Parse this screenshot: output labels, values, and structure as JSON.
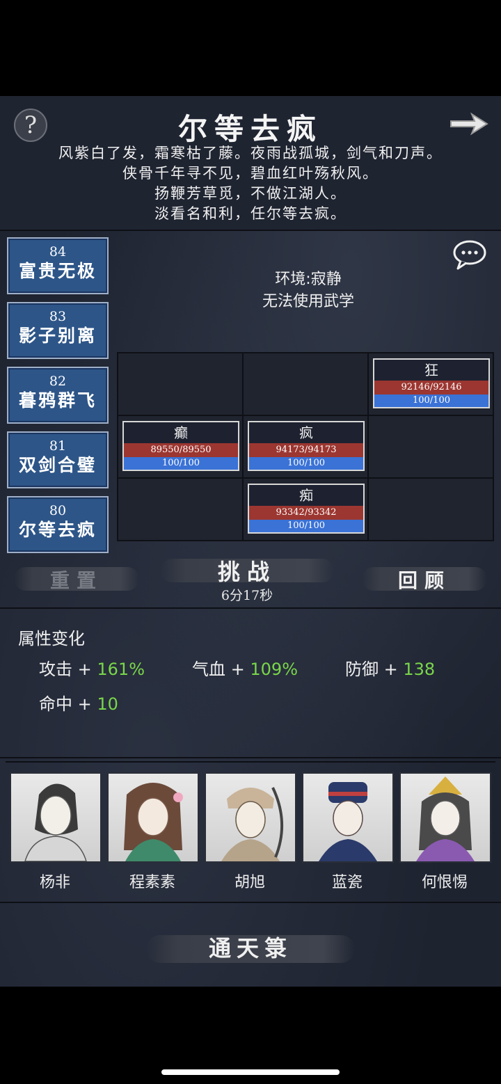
{
  "header": {
    "help_symbol": "?",
    "title": "尔等去疯",
    "poem": [
      "风紫白了发，霜寒枯了藤。夜雨战孤城，剑气和刀声。",
      "侠骨千年寻不见，碧血红叶殇秋风。",
      "扬鞭芳草觅，不做江湖人。",
      "淡看名和利，任尔等去疯。"
    ]
  },
  "stages": [
    {
      "num": "84",
      "name": "富贵无极"
    },
    {
      "num": "83",
      "name": "影子别离"
    },
    {
      "num": "82",
      "name": "暮鸦群飞"
    },
    {
      "num": "81",
      "name": "双剑合璧"
    },
    {
      "num": "80",
      "name": "尔等去疯"
    }
  ],
  "environment": {
    "line1": "环境:寂静",
    "line2": "无法使用武学"
  },
  "enemies": {
    "kuang": {
      "name": "狂",
      "hp": "92146/92146",
      "mp": "100/100"
    },
    "dian": {
      "name": "癫",
      "hp": "89550/89550",
      "mp": "100/100"
    },
    "feng": {
      "name": "疯",
      "hp": "94173/94173",
      "mp": "100/100"
    },
    "chi": {
      "name": "痴",
      "hp": "93342/93342",
      "mp": "100/100"
    }
  },
  "actions": {
    "reset": "重置",
    "challenge": "挑战",
    "timer": "6分17秒",
    "review": "回顾"
  },
  "attributes": {
    "heading": "属性变化",
    "attack": {
      "label": "攻击 +",
      "value": "161%"
    },
    "hp": {
      "label": "气血 +",
      "value": "109%"
    },
    "defense": {
      "label": "防御 +",
      "value": "138"
    },
    "hit": {
      "label": "命中 +",
      "value": "10"
    }
  },
  "characters": [
    {
      "name": "杨非"
    },
    {
      "name": "程素素"
    },
    {
      "name": "胡旭"
    },
    {
      "name": "蓝瓷"
    },
    {
      "name": "何恨惕"
    }
  ],
  "tower": {
    "label": "通天箓"
  },
  "colors": {
    "stage_bg": "#2d5588",
    "hp_bar": "#9c3630",
    "mp_bar": "#3a72d6",
    "stat_value": "#79d64a"
  }
}
